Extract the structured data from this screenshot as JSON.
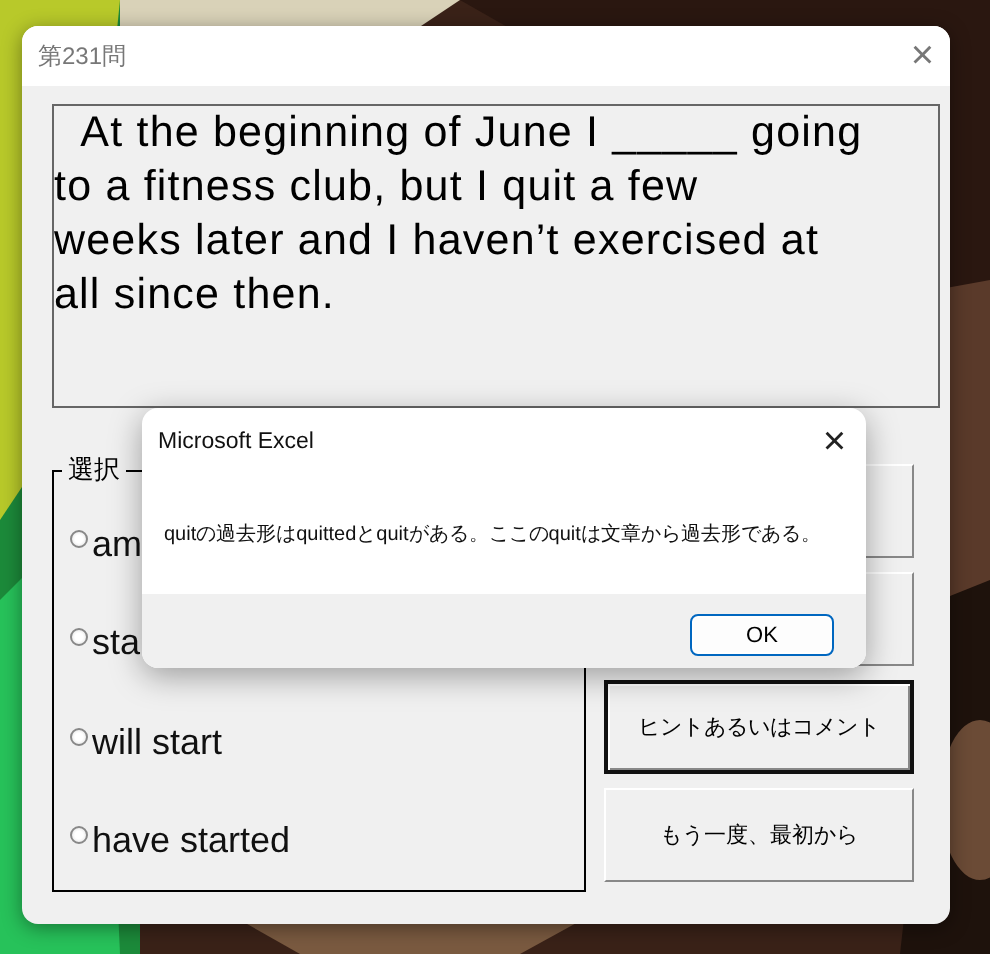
{
  "window": {
    "title": "第231問",
    "close": "×"
  },
  "question": {
    "text": "  At the beginning of June I _____ going\nto a fitness club, but I quit a few\nweeks later and I haven’t exercised at\nall since then."
  },
  "choices": {
    "label": "選択",
    "options": [
      {
        "label": "am",
        "selected": false
      },
      {
        "label": "sta",
        "selected": false
      },
      {
        "label": "will start",
        "selected": false
      },
      {
        "label": "have started",
        "selected": false
      }
    ]
  },
  "buttons": [
    {
      "focused": false
    },
    {
      "focused": false
    },
    {
      "label": "ヒントあるいはコメント",
      "focused": true
    },
    {
      "label": "もう一度、最初から",
      "focused": false
    }
  ],
  "dialog": {
    "title": "Microsoft Excel",
    "close": "×",
    "message": "quitの過去形はquittedとquitがある。ここのquitは文章から過去形である。",
    "button": "OK"
  }
}
